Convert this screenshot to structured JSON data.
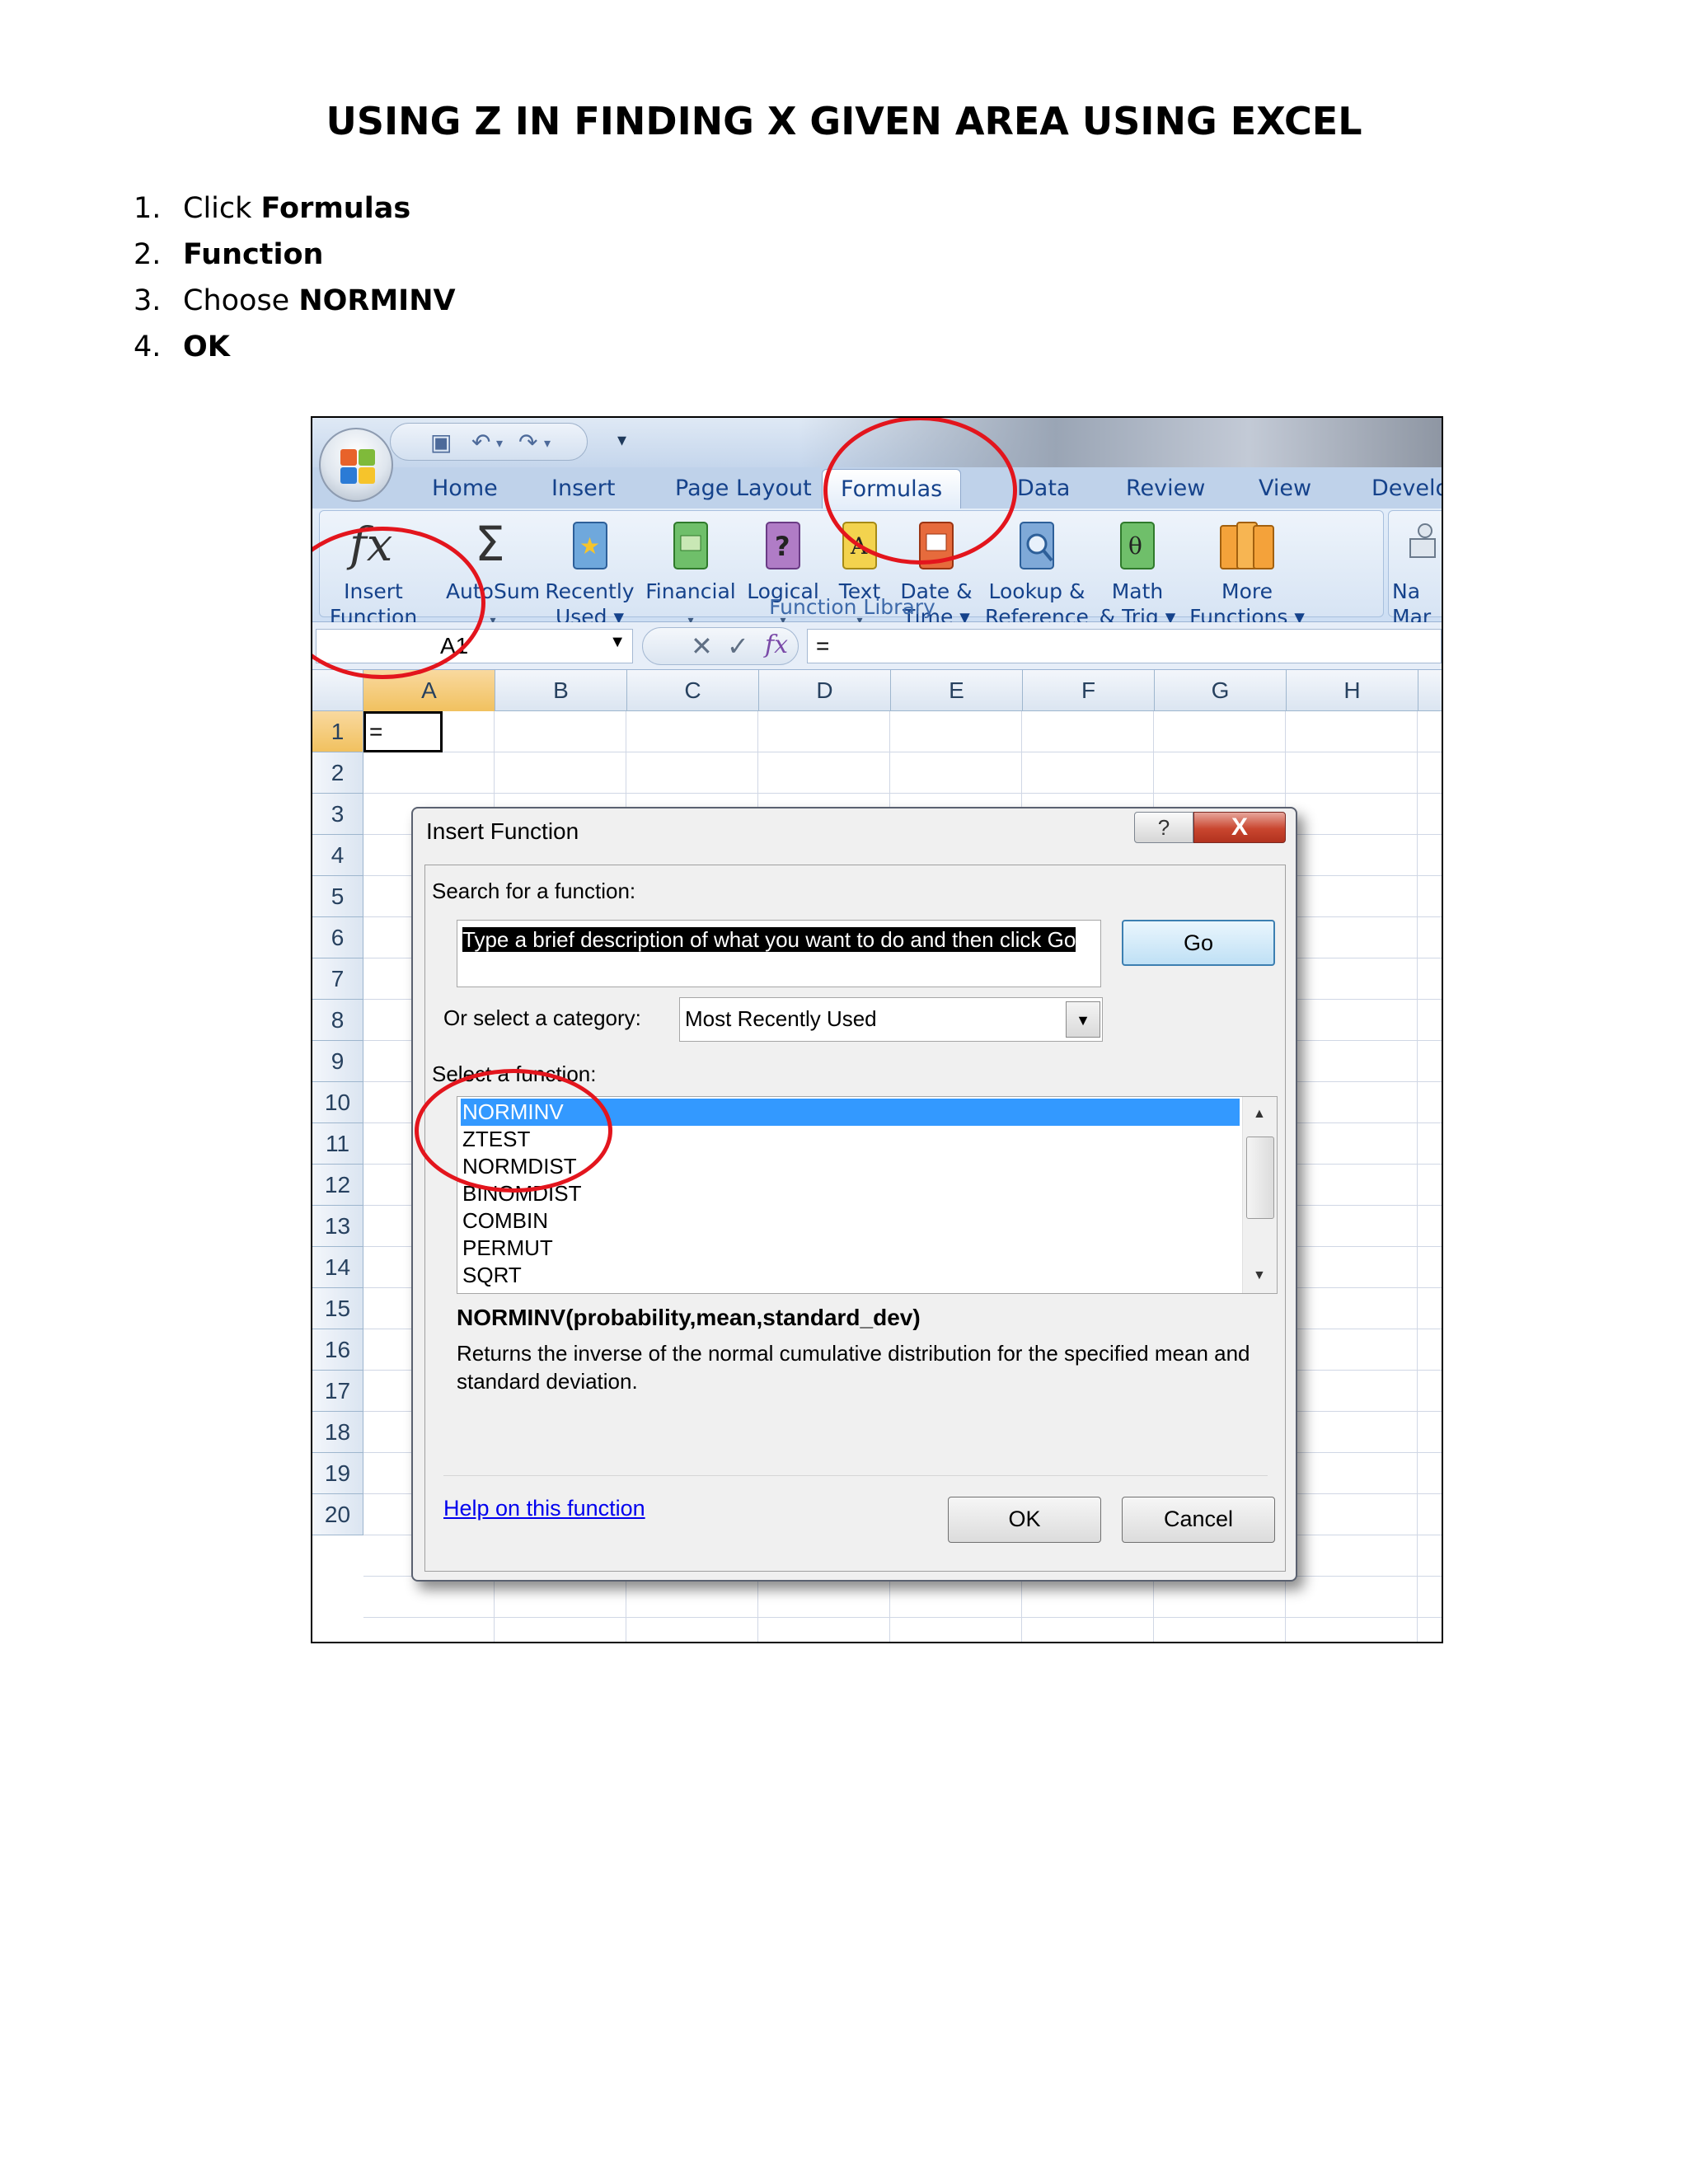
{
  "document": {
    "title": "USING Z IN FINDING X GIVEN AREA USING EXCEL",
    "steps": [
      {
        "num": "1.",
        "prefix": "Click ",
        "bold": "Formulas"
      },
      {
        "num": "2.",
        "prefix": "",
        "bold": "Function"
      },
      {
        "num": "3.",
        "prefix": "Choose ",
        "bold": "NORMINV"
      },
      {
        "num": "4.",
        "prefix": "",
        "bold": "OK"
      }
    ]
  },
  "excel": {
    "qat_more": "▾",
    "tabs": [
      "Home",
      "Insert",
      "Page Layout",
      "Formulas",
      "Data",
      "Review",
      "View",
      "Develo"
    ],
    "ribbon_buttons": [
      {
        "line1": "Insert",
        "line2": "Function",
        "icon": "fx-icon"
      },
      {
        "line1": "AutoSum",
        "line2": "▾",
        "icon": "sigma-icon"
      },
      {
        "line1": "Recently",
        "line2": "Used ▾",
        "icon": "book-star-icon"
      },
      {
        "line1": "Financial",
        "line2": "▾",
        "icon": "book-money-icon"
      },
      {
        "line1": "Logical",
        "line2": "▾",
        "icon": "book-question-icon"
      },
      {
        "line1": "Text",
        "line2": "▾",
        "icon": "book-text-icon"
      },
      {
        "line1": "Date &",
        "line2": "Time ▾",
        "icon": "book-calendar-icon"
      },
      {
        "line1": "Lookup &",
        "line2": "Reference ▾",
        "icon": "book-magnifier-icon"
      },
      {
        "line1": "Math",
        "line2": "& Trig ▾",
        "icon": "book-theta-icon"
      },
      {
        "line1": "More",
        "line2": "Functions ▾",
        "icon": "books-icon"
      }
    ],
    "right_partial": {
      "line1": "Na",
      "line2": "Mar"
    },
    "group_label": "Function Library",
    "name_box": "A1",
    "formula_value": "=",
    "columns": [
      "A",
      "B",
      "C",
      "D",
      "E",
      "F",
      "G",
      "H"
    ],
    "rows": [
      "1",
      "2",
      "3",
      "4",
      "5",
      "6",
      "7",
      "8",
      "9",
      "10",
      "11",
      "12",
      "13",
      "14",
      "15",
      "16",
      "17",
      "18",
      "19",
      "20"
    ],
    "cell_a1": "="
  },
  "dialog": {
    "title": "Insert Function",
    "help_glyph": "?",
    "close_glyph": "X",
    "search_label": "Search for a function:",
    "search_text": "Type a brief description of what you want to do and then click Go",
    "go_label": "Go",
    "category_label": "Or select a category:",
    "category_value": "Most Recently Used",
    "select_label": "Select a function:",
    "functions": [
      "NORMINV",
      "ZTEST",
      "NORMDIST",
      "BINOMDIST",
      "COMBIN",
      "PERMUT",
      "SQRT"
    ],
    "selected_index": 0,
    "signature": "NORMINV(probability,mean,standard_dev)",
    "description": "Returns the inverse of the normal cumulative distribution for the specified mean and standard deviation.",
    "help_link": "Help on this function",
    "ok_label": "OK",
    "cancel_label": "Cancel"
  },
  "colors": {
    "annotation_ring": "#e3151d",
    "selection": "#3399ff",
    "ribbon_text": "#15428b"
  }
}
